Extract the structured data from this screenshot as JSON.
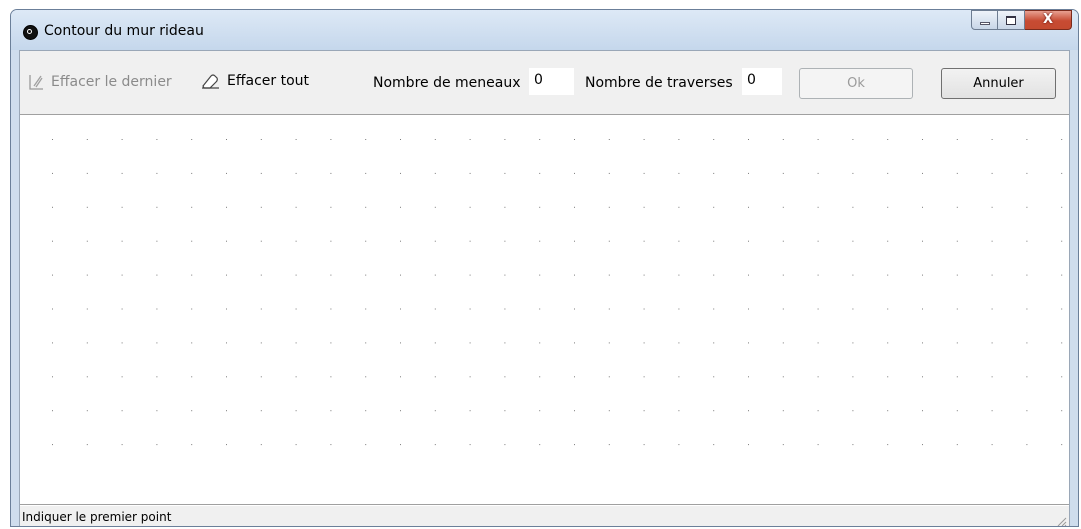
{
  "window": {
    "title": "Contour du mur rideau",
    "icon": "target-icon",
    "caption_buttons": [
      "minimize",
      "maximize",
      "close"
    ],
    "close_glyph": "X"
  },
  "toolbar": {
    "undo_label": "Effacer le dernier",
    "undo_enabled": false,
    "clear_label": "Effacer tout",
    "meneaux_label": "Nombre de meneaux",
    "meneaux_value": "0",
    "traverses_label": "Nombre de traverses",
    "traverses_value": "0",
    "ok_label": "Ok",
    "ok_enabled": false,
    "cancel_label": "Annuler"
  },
  "canvas": {
    "grid": "dots",
    "dot_color": "#7a7a7a"
  },
  "status": {
    "text": "Indiquer le premier point"
  },
  "colors": {
    "title_bar": "#cfdded",
    "close_button": "#c74b33",
    "disabled_text": "#8b8b8b"
  }
}
